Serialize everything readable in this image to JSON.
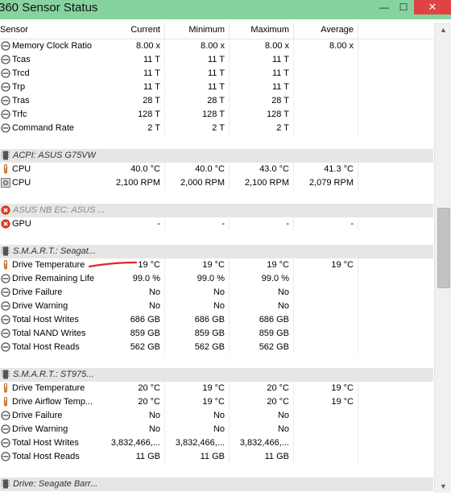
{
  "window": {
    "title": "360 Sensor Status",
    "minimize": "—",
    "maximize": "☐",
    "close": "✕"
  },
  "columns": [
    "Sensor",
    "Current",
    "Minimum",
    "Maximum",
    "Average"
  ],
  "rows": [
    {
      "type": "sensor",
      "icon": "clock",
      "name": "Memory Clock Ratio",
      "current": "8.00 x",
      "minimum": "8.00 x",
      "maximum": "8.00 x",
      "average": "8.00 x"
    },
    {
      "type": "sensor",
      "icon": "clock",
      "name": "Tcas",
      "current": "11 T",
      "minimum": "11 T",
      "maximum": "11 T",
      "average": ""
    },
    {
      "type": "sensor",
      "icon": "clock",
      "name": "Trcd",
      "current": "11 T",
      "minimum": "11 T",
      "maximum": "11 T",
      "average": ""
    },
    {
      "type": "sensor",
      "icon": "clock",
      "name": "Trp",
      "current": "11 T",
      "minimum": "11 T",
      "maximum": "11 T",
      "average": ""
    },
    {
      "type": "sensor",
      "icon": "clock",
      "name": "Tras",
      "current": "28 T",
      "minimum": "28 T",
      "maximum": "28 T",
      "average": ""
    },
    {
      "type": "sensor",
      "icon": "clock",
      "name": "Trfc",
      "current": "128 T",
      "minimum": "128 T",
      "maximum": "128 T",
      "average": ""
    },
    {
      "type": "sensor",
      "icon": "clock",
      "name": "Command Rate",
      "current": "2 T",
      "minimum": "2 T",
      "maximum": "2 T",
      "average": ""
    },
    {
      "type": "blank"
    },
    {
      "type": "group",
      "icon": "chip",
      "name": "ACPI: ASUS G75VW"
    },
    {
      "type": "sensor",
      "icon": "thermometer",
      "name": "CPU",
      "current": "40.0 °C",
      "minimum": "40.0 °C",
      "maximum": "43.0 °C",
      "average": "41.3 °C"
    },
    {
      "type": "sensor",
      "icon": "fan",
      "name": "CPU",
      "current": "2,100 RPM",
      "minimum": "2,000 RPM",
      "maximum": "2,100 RPM",
      "average": "2,079 RPM"
    },
    {
      "type": "blank"
    },
    {
      "type": "group",
      "icon": "error",
      "name": "ASUS NB EC: ASUS ...",
      "muted": true
    },
    {
      "type": "sensor",
      "icon": "error",
      "name": "GPU",
      "current": "-",
      "minimum": "-",
      "maximum": "-",
      "average": "-"
    },
    {
      "type": "blank"
    },
    {
      "type": "group",
      "icon": "chip",
      "name": "S.M.A.R.T.: Seagat..."
    },
    {
      "type": "sensor",
      "icon": "thermometer",
      "name": "Drive Temperature",
      "current": "19 °C",
      "minimum": "19 °C",
      "maximum": "19 °C",
      "average": "19 °C"
    },
    {
      "type": "sensor",
      "icon": "clock",
      "name": "Drive Remaining Life",
      "current": "99.0 %",
      "minimum": "99.0 %",
      "maximum": "99.0 %",
      "average": ""
    },
    {
      "type": "sensor",
      "icon": "clock",
      "name": "Drive Failure",
      "current": "No",
      "minimum": "No",
      "maximum": "No",
      "average": ""
    },
    {
      "type": "sensor",
      "icon": "clock",
      "name": "Drive Warning",
      "current": "No",
      "minimum": "No",
      "maximum": "No",
      "average": ""
    },
    {
      "type": "sensor",
      "icon": "clock",
      "name": "Total Host Writes",
      "current": "686 GB",
      "minimum": "686 GB",
      "maximum": "686 GB",
      "average": ""
    },
    {
      "type": "sensor",
      "icon": "clock",
      "name": "Total NAND Writes",
      "current": "859 GB",
      "minimum": "859 GB",
      "maximum": "859 GB",
      "average": ""
    },
    {
      "type": "sensor",
      "icon": "clock",
      "name": "Total Host Reads",
      "current": "562 GB",
      "minimum": "562 GB",
      "maximum": "562 GB",
      "average": ""
    },
    {
      "type": "blank"
    },
    {
      "type": "group",
      "icon": "chip",
      "name": "S.M.A.R.T.: ST975..."
    },
    {
      "type": "sensor",
      "icon": "thermometer",
      "name": "Drive Temperature",
      "current": "20 °C",
      "minimum": "19 °C",
      "maximum": "20 °C",
      "average": "19 °C"
    },
    {
      "type": "sensor",
      "icon": "thermometer",
      "name": "Drive Airflow Temp...",
      "current": "20 °C",
      "minimum": "19 °C",
      "maximum": "20 °C",
      "average": "19 °C"
    },
    {
      "type": "sensor",
      "icon": "clock",
      "name": "Drive Failure",
      "current": "No",
      "minimum": "No",
      "maximum": "No",
      "average": ""
    },
    {
      "type": "sensor",
      "icon": "clock",
      "name": "Drive Warning",
      "current": "No",
      "minimum": "No",
      "maximum": "No",
      "average": ""
    },
    {
      "type": "sensor",
      "icon": "clock",
      "name": "Total Host Writes",
      "current": "3,832,466,...",
      "minimum": "3,832,466,...",
      "maximum": "3,832,466,...",
      "average": ""
    },
    {
      "type": "sensor",
      "icon": "clock",
      "name": "Total Host Reads",
      "current": "11 GB",
      "minimum": "11 GB",
      "maximum": "11 GB",
      "average": ""
    },
    {
      "type": "blank"
    },
    {
      "type": "group",
      "icon": "chip",
      "name": "Drive: Seagate Barr..."
    }
  ],
  "colors": {
    "titlebar": "#87d39f",
    "close": "#e04343",
    "group_row": "#e6e6e6",
    "annotation": "#e02424"
  }
}
